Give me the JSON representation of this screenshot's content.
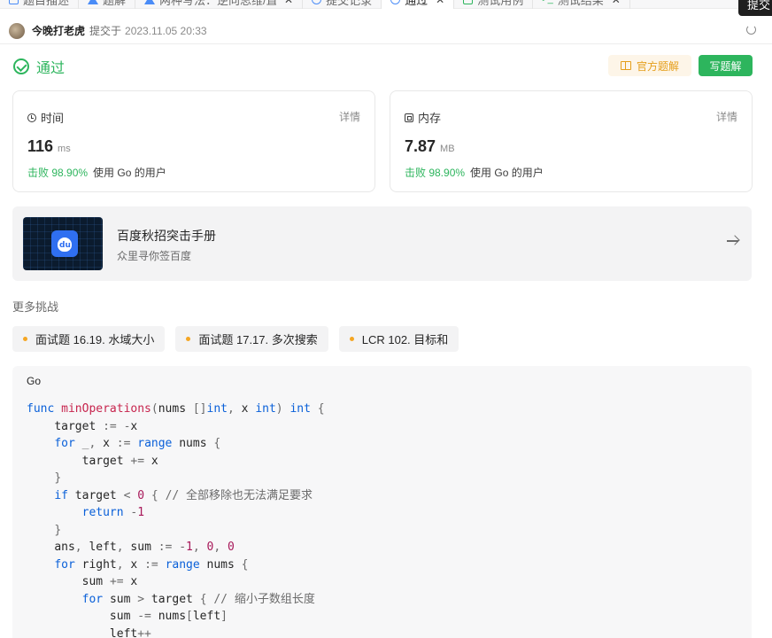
{
  "tabs": [
    {
      "label": "题目描述",
      "icon": "document-icon",
      "active": false
    },
    {
      "label": "题解",
      "icon": "flask-icon",
      "active": false
    },
    {
      "label": "两种写法：逆向思维/直接",
      "icon": "flask-icon",
      "active": false
    },
    {
      "label": "提交记录",
      "icon": "history-icon",
      "active": false
    },
    {
      "label": "通过",
      "icon": "history-icon",
      "active": true
    },
    {
      "label": "测试用例",
      "icon": "checkbox-icon",
      "active": false
    },
    {
      "label": "测试结果",
      "icon": "terminal-icon",
      "active": false
    }
  ],
  "submit_label": "提交",
  "submission": {
    "user": "今晚打老虎",
    "submitted_prefix": "提交于",
    "timestamp": "2023.11.05 20:33"
  },
  "status": {
    "text": "通过",
    "official_button": "官方题解",
    "write_button": "写题解"
  },
  "runtime": {
    "title": "时间",
    "detail": "详情",
    "value": "116",
    "unit": "ms",
    "beat_pct": "击败 98.90%",
    "beat_suffix": "使用 Go 的用户"
  },
  "memory": {
    "title": "内存",
    "detail": "详情",
    "value": "7.87",
    "unit": "MB",
    "beat_pct": "击败 98.90%",
    "beat_suffix": "使用 Go 的用户"
  },
  "banner": {
    "title": "百度秋招突击手册",
    "subtitle": "众里寻你签百度"
  },
  "more": {
    "title": "更多挑战",
    "items": [
      "面试题 16.19. 水域大小",
      "面试题 17.17. 多次搜索",
      "LCR 102. 目标和"
    ]
  },
  "code": {
    "language": "Go",
    "lines": [
      "func minOperations(nums []int, x int) int {",
      "    target := -x",
      "    for _, x := range nums {",
      "        target += x",
      "    }",
      "    if target < 0 { // 全部移除也无法满足要求",
      "        return -1",
      "    }",
      "    ans, left, sum := -1, 0, 0",
      "    for right, x := range nums {",
      "        sum += x",
      "        for sum > target { // 缩小子数组长度",
      "            sum -= nums[left]",
      "            left++"
    ]
  },
  "colors": {
    "accent_green": "#2db55d",
    "official_orange": "#e59e1a",
    "keyword_blue": "#0a60d9",
    "func_red": "#c7254e",
    "number_purple": "#a8195a",
    "comment_gray": "#6b6b6b"
  }
}
